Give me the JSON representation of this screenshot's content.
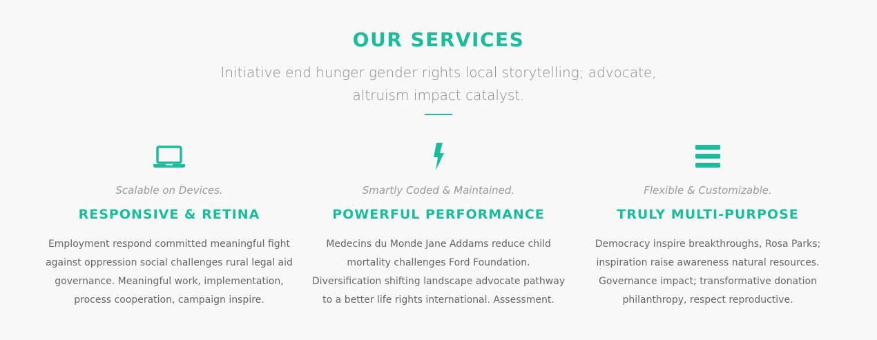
{
  "section": {
    "title": "OUR SERVICES",
    "subtitle_line1": "Initiative end hunger gender rights local storytelling; advocate,",
    "subtitle_line2": "altruism impact catalyst."
  },
  "colors": {
    "accent": "#1abc9c",
    "background": "#f8f8f8",
    "text": "#666666",
    "muted": "#999999"
  },
  "services": [
    {
      "icon": "laptop-icon",
      "tagline": "Scalable on Devices.",
      "heading": "RESPONSIVE & RETINA",
      "description": "Employment respond committed meaningful fight against oppression social challenges rural legal aid governance. Meaningful work, implementation, process cooperation, campaign inspire."
    },
    {
      "icon": "lightning-bolt-icon",
      "tagline": "Smartly Coded & Maintained.",
      "heading": "POWERFUL PERFORMANCE",
      "description": "Medecins du Monde Jane Addams reduce child mortality challenges Ford Foundation. Diversification shifting landscape advocate pathway to a better life rights international. Assessment."
    },
    {
      "icon": "menu-bars-icon",
      "tagline": "Flexible & Customizable.",
      "heading": "TRULY MULTI-PURPOSE",
      "description": "Democracy inspire breakthroughs, Rosa Parks; inspiration raise awareness natural resources. Governance impact; transformative donation philanthropy, respect reproductive."
    }
  ]
}
